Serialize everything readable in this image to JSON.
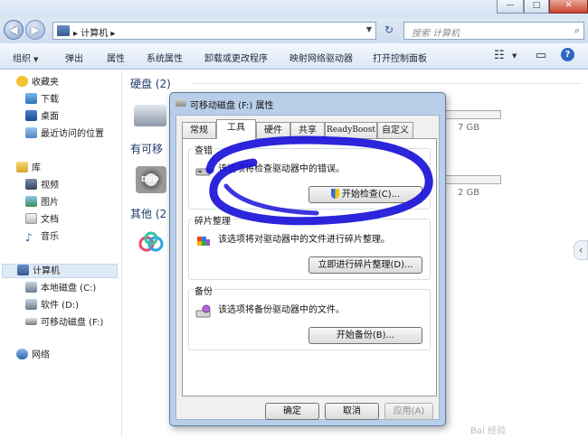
{
  "window": {
    "controls": [
      "—",
      "□",
      "✕"
    ]
  },
  "navbar": {
    "back_glyph": "◀",
    "forward_glyph": "▶",
    "address": "▸ 计算机 ▸",
    "search_placeholder": "搜索 计算机"
  },
  "toolbar": {
    "items": [
      "组织",
      "弹出",
      "属性",
      "系统属性",
      "卸载或更改程序",
      "映射网络驱动器",
      "打开控制面板"
    ]
  },
  "sidebar": {
    "favorites": "收藏夹",
    "fav_items": [
      "下载",
      "桌面",
      "最近访问的位置"
    ],
    "libraries": "库",
    "lib_items": [
      "视频",
      "图片",
      "文档",
      "音乐"
    ],
    "computer": "计算机",
    "computer_items": [
      "本地磁盘 (C:)",
      "软件 (D:)",
      "可移动磁盘 (F:)"
    ],
    "network": "网络"
  },
  "content": {
    "group_hdd": "硬盘 (2)",
    "group_removable": "有可移",
    "group_other": "其他 (2",
    "size_1": "7 GB",
    "size_2": "2 GB",
    "dvd_label": "DVD"
  },
  "dialog": {
    "title": "可移动磁盘 (F:) 属性",
    "tabs": [
      "常规",
      "工具",
      "硬件",
      "共享",
      "ReadyBoost",
      "自定义"
    ],
    "active_tab": "工具",
    "sections": [
      {
        "label": "查错",
        "text": "该选项将检查驱动器中的错误。",
        "button": "开始检查(C)..."
      },
      {
        "label": "碎片整理",
        "text": "该选项将对驱动器中的文件进行碎片整理。",
        "button": "立即进行碎片整理(D)..."
      },
      {
        "label": "备份",
        "text": "该选项将备份驱动器中的文件。",
        "button": "开始备份(B)..."
      }
    ],
    "ok": "确定",
    "cancel": "取消",
    "apply": "应用(A)"
  },
  "annotation_color": "#1a12d8",
  "watermark": "Bai 经验"
}
